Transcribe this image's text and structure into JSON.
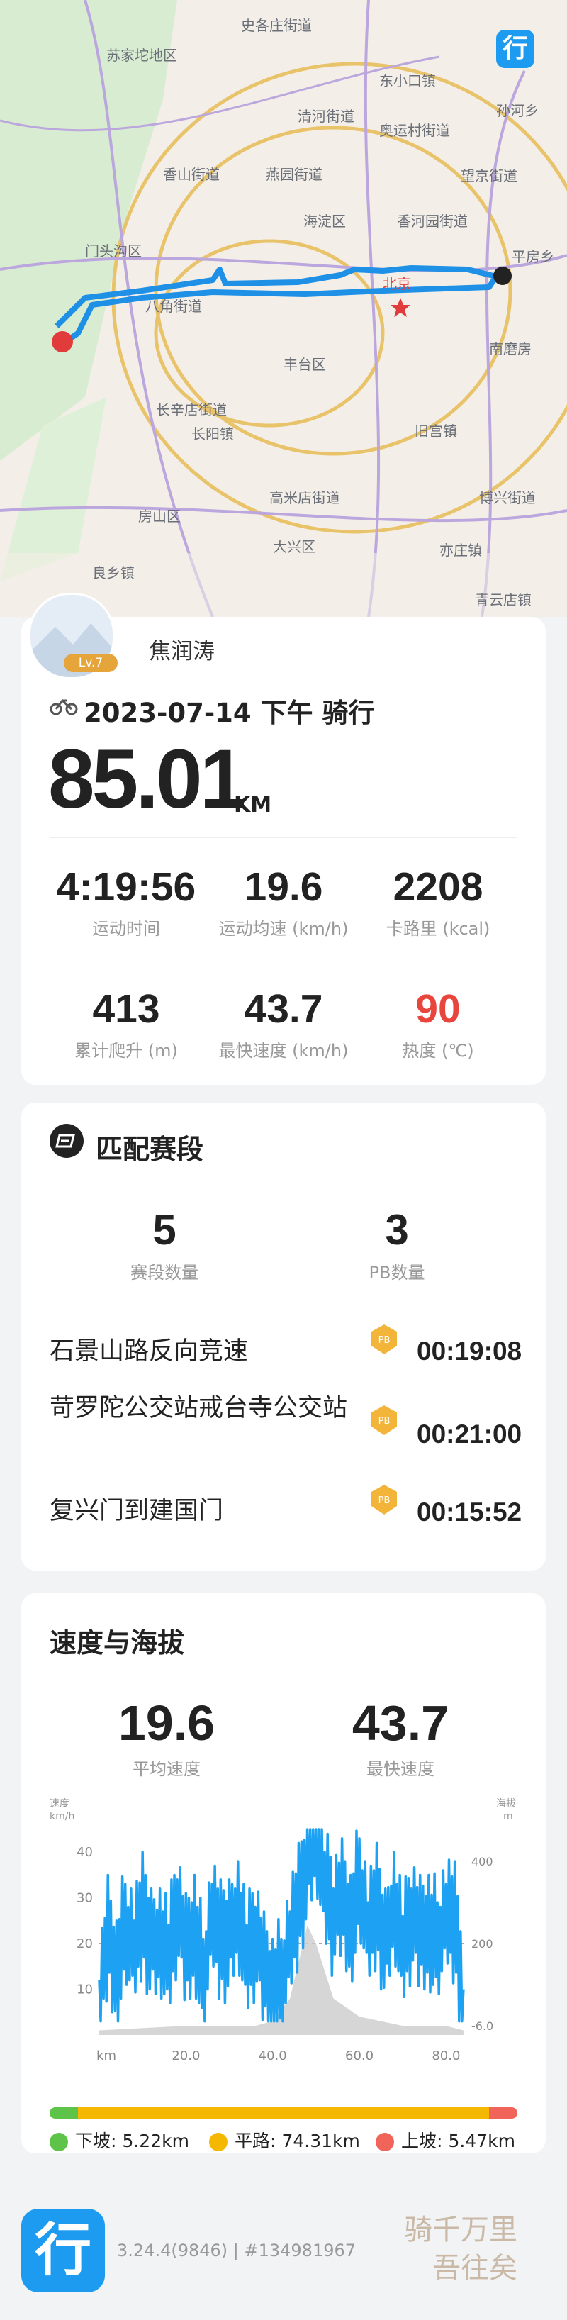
{
  "map": {
    "labels": [
      "史各庄街道",
      "苏家坨地区",
      "东小口镇",
      "清河街道",
      "孙河乡",
      "奥运村街道",
      "香山街道",
      "燕园街道",
      "望京街道",
      "海淀区",
      "香河园街道",
      "门头沟区",
      "平房乡",
      "八角街道",
      "北京",
      "南磨房",
      "丰台区",
      "长辛店街道",
      "旧宫镇",
      "博兴街道",
      "房山区",
      "高米店街道",
      "大兴区",
      "良乡镇",
      "长阳镇",
      "亦庄镇",
      "青云店镇"
    ],
    "app_badge": "行"
  },
  "profile": {
    "name": "焦润涛",
    "level": "Lv.7",
    "activity": "2023-07-14 下午 骑行",
    "distance": "85.01",
    "distance_unit": "KM"
  },
  "stats": [
    {
      "value": "4:19:56",
      "label": "运动时间"
    },
    {
      "value": "19.6",
      "label": "运动均速 (km/h)"
    },
    {
      "value": "2208",
      "label": "卡路里 (kcal)"
    },
    {
      "value": "413",
      "label": "累计爬升 (m)"
    },
    {
      "value": "43.7",
      "label": "最快速度 (km/h)"
    },
    {
      "value": "90",
      "label": "热度 (℃)",
      "color": "#e8453c"
    }
  ],
  "segments": {
    "title": "匹配赛段",
    "count_value": "5",
    "count_label": "赛段数量",
    "pb_value": "3",
    "pb_label": "PB数量",
    "pb_badge": "PB",
    "items": [
      {
        "name": "石景山路反向竞速",
        "time": "00:19:08"
      },
      {
        "name": "苛罗陀公交站戒台寺公交站",
        "time": "00:21:00"
      },
      {
        "name": "复兴门到建国门",
        "time": "00:15:52"
      }
    ]
  },
  "speed_section": {
    "title": "速度与海拔",
    "avg_value": "19.6",
    "avg_label": "平均速度",
    "max_value": "43.7",
    "max_label": "最快速度"
  },
  "chart_data": {
    "type": "line",
    "xlabel": "km",
    "ylabel_left": "速度 km/h",
    "ylabel_right": "海拔 m",
    "x_ticks": [
      "km",
      "20.0",
      "40.0",
      "60.0",
      "80.0"
    ],
    "y_left_ticks": [
      "40",
      "30",
      "20",
      "10"
    ],
    "y_right_ticks": [
      "400",
      "200",
      "-6.0"
    ],
    "ylim_left": [
      0,
      45
    ],
    "xlim": [
      0,
      85
    ],
    "series": [
      {
        "color": "#1da1f2",
        "x": [
          0,
          2,
          4,
          6,
          8,
          10,
          12,
          14,
          16,
          18,
          20,
          22,
          24,
          26,
          28,
          30,
          32,
          34,
          36,
          38,
          40,
          42,
          44,
          46,
          48,
          50,
          52,
          54,
          56,
          58,
          60,
          62,
          64,
          66,
          68,
          70,
          72,
          74,
          76,
          78,
          80,
          82,
          84
        ],
        "y": [
          6,
          22,
          14,
          24,
          18,
          26,
          20,
          22,
          16,
          28,
          18,
          24,
          12,
          26,
          20,
          22,
          28,
          16,
          22,
          14,
          10,
          12,
          20,
          28,
          38,
          45,
          32,
          26,
          30,
          24,
          34,
          22,
          28,
          20,
          30,
          18,
          26,
          22,
          24,
          20,
          26,
          24,
          10
        ]
      },
      {
        "color": "#cccccc",
        "x": [
          0,
          20,
          36,
          40,
          44,
          46,
          48,
          50,
          54,
          60,
          70,
          80,
          84
        ],
        "y": [
          1,
          2,
          2,
          3,
          8,
          16,
          24,
          20,
          8,
          4,
          2,
          2,
          1
        ]
      }
    ],
    "grade_bar": [
      {
        "label": "下坡",
        "value": "5.22km",
        "color": "#5ec449"
      },
      {
        "label": "平路",
        "value": "74.31km",
        "color": "#f5b800"
      },
      {
        "label": "上坡",
        "value": "5.47km",
        "color": "#f0645a"
      }
    ]
  },
  "footer": {
    "logo": "行",
    "version": "3.24.4(9846) | #134981967",
    "slogan_line1": "骑千万里",
    "slogan_line2": "吾往矣"
  }
}
